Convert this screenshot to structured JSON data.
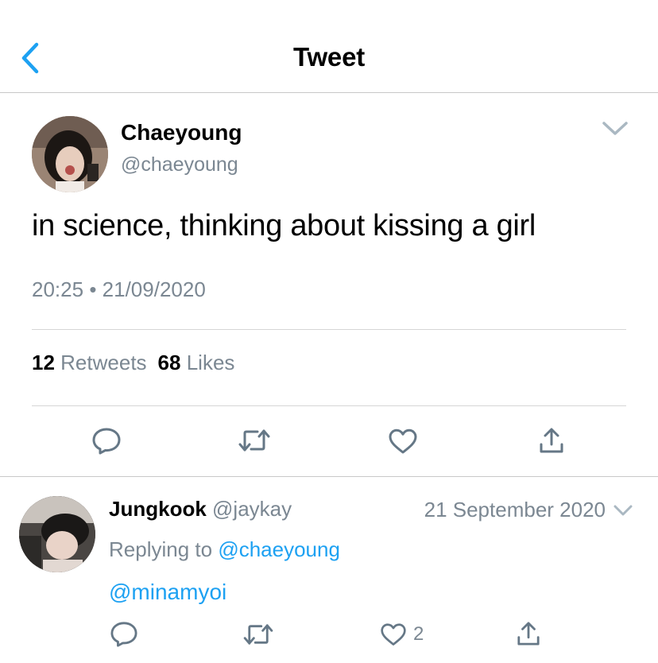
{
  "header": {
    "title": "Tweet"
  },
  "tweet": {
    "name": "Chaeyoung",
    "handle": "@chaeyoung",
    "text": "in science, thinking about kissing a girl",
    "time": "20:25",
    "separator": "•",
    "date": "21/09/2020",
    "retweets_count": "12",
    "retweets_label": "Retweets",
    "likes_count": "68",
    "likes_label": "Likes"
  },
  "reply": {
    "name": "Jungkook",
    "handle": "@jaykay",
    "date": "21 September 2020",
    "replying_prefix": "Replying to",
    "replying_to": "@chaeyoung",
    "text": "@minamyoi",
    "like_count": "2"
  },
  "icons": [
    "back-chevron-icon",
    "chevron-down-icon",
    "reply-icon",
    "retweet-icon",
    "like-icon",
    "share-icon"
  ],
  "colors": {
    "accent": "#1da1f2",
    "secondary_text": "#7b8792",
    "icon_gray": "#657786"
  }
}
